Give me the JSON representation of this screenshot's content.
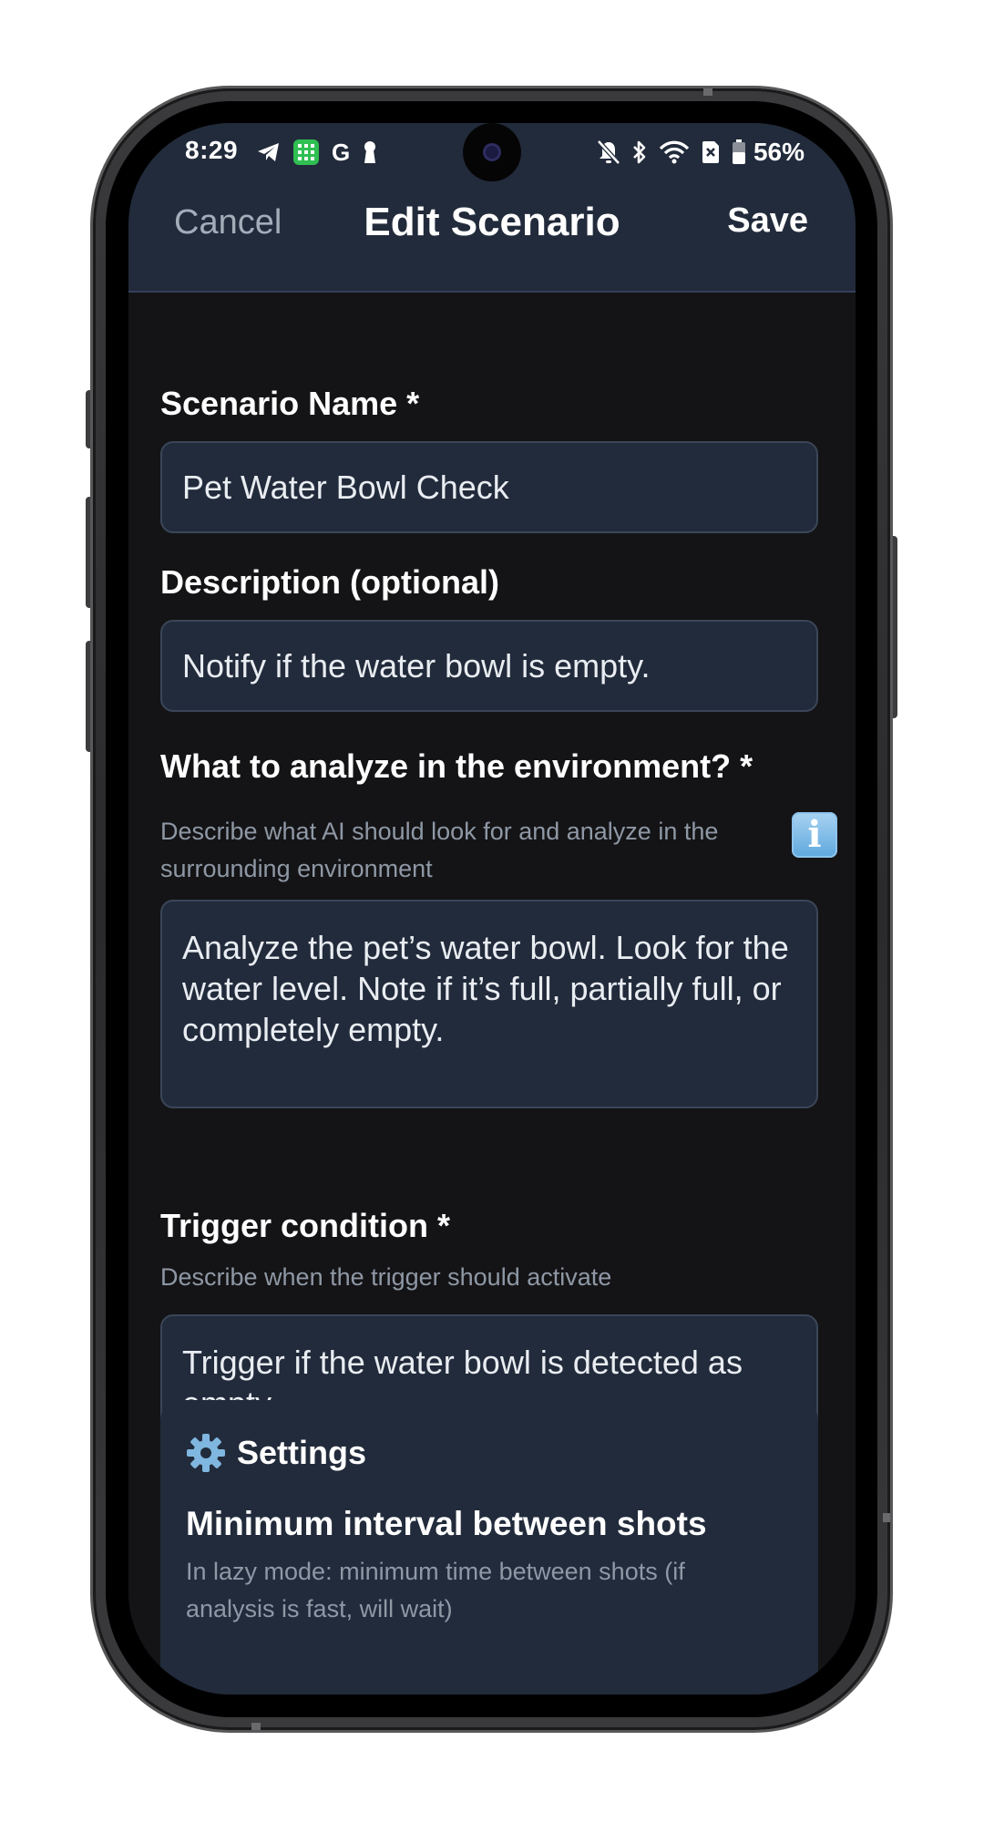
{
  "status_bar": {
    "time": "8:29",
    "left_icons": [
      "telegram-icon",
      "calculator-app-icon",
      "google-icon",
      "keyhole-icon"
    ],
    "google_letter": "G",
    "right_icons": [
      "bell-muted-icon",
      "bluetooth-icon",
      "wifi-icon",
      "sim-off-icon",
      "battery-icon"
    ],
    "battery_percent": "56%"
  },
  "nav": {
    "cancel_label": "Cancel",
    "title": "Edit Scenario",
    "save_label": "Save"
  },
  "form": {
    "scenario_name": {
      "label": "Scenario Name *",
      "value": "Pet Water Bowl Check"
    },
    "description": {
      "label": "Description (optional)",
      "value": "Notify if the water bowl is empty."
    },
    "analyze": {
      "label": "What to analyze in the environment? *",
      "info_icon": "info-icon",
      "hint": "Describe what AI should look for and analyze in the surrounding environment",
      "value": "Analyze the pet’s water bowl. Look for the water level. Note if it’s full, partially full, or completely empty."
    },
    "trigger": {
      "label": "Trigger condition *",
      "hint": "Describe when the trigger should activate",
      "value": "Trigger if the water bowl is detected as empty."
    }
  },
  "settings": {
    "icon": "gear-icon",
    "title": "Settings",
    "min_interval": {
      "title": "Minimum interval between shots",
      "hint": "In lazy mode: minimum time between shots (if analysis is fast, will wait)"
    }
  },
  "colors": {
    "header_bg": "#222b3b",
    "screen_bg": "#141416",
    "field_bg": "#222b3b",
    "field_border": "#3a4658",
    "hint_text": "#8f98a5",
    "cancel_text": "#a3adba"
  }
}
